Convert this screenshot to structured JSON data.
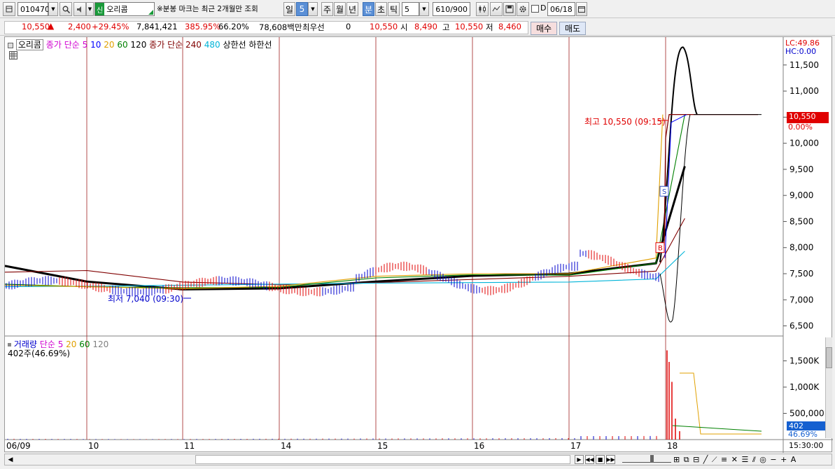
{
  "toolbar": {
    "code": "010470",
    "sin_badge": "신",
    "stock_name": "오리콤",
    "note": "※분봉 마크는 최근 2개월만 조회",
    "periods": [
      "일",
      "5",
      "주",
      "월",
      "년",
      "분",
      "초",
      "틱"
    ],
    "interval": "5",
    "count": "610/900",
    "checkbox_label": "D",
    "date": "06/18"
  },
  "quote": {
    "price": "10,550",
    "change": "2,400",
    "change_pct": "+29.45%",
    "volume": "7,841,421",
    "volume_ratio": "385.95%",
    "turnover_rate": "66.20%",
    "amount": "78,608백만",
    "best_label": "최우선",
    "best_value": "0",
    "price2": "10,550",
    "open_label": "시",
    "open": "8,490",
    "high_label": "고",
    "high": "10,550",
    "low_label": "저",
    "low": "8,460",
    "buy": "매수",
    "sell": "매도"
  },
  "price_legend": {
    "name": "오리콤",
    "close_label": "종가",
    "simple_label": "단순",
    "ma": [
      "5",
      "10",
      "20",
      "60",
      "120"
    ],
    "close_label2": "종가",
    "simple_label2": "단순",
    "ma2": [
      "240",
      "480"
    ],
    "upper": "상한선",
    "lower": "하한선"
  },
  "volume_legend": {
    "name": "거래량",
    "simple_label": "단순",
    "ma": [
      "5",
      "20",
      "60",
      "120"
    ],
    "current": "402주(46.69%)"
  },
  "annotations": {
    "high": "최고 10,550 (09:15)",
    "low": "최저 7,040 (09:30)",
    "sell_marker": "S",
    "buy_marker": "B",
    "lc": "LC:49.86",
    "hc": "HC:0.00",
    "last_price": "10,550",
    "last_pct": "0.00%",
    "vol_last": "402",
    "vol_pct": "46.69%",
    "time": "15:30:00"
  },
  "colors": {
    "up": "#e00000",
    "down": "#0000cc",
    "ma5": "#d000d0",
    "ma10": "#0000ff",
    "ma20": "#e0a000",
    "ma60": "#008000",
    "ma120": "#808080",
    "ma240": "#800000",
    "ma480": "#00b4d8"
  },
  "chart_data": {
    "type": "line",
    "price_axis": [
      "11,500",
      "11,000",
      "10,500",
      "10,000",
      "9,500",
      "9,000",
      "8,500",
      "8,000",
      "7,500",
      "7,000",
      "6,500"
    ],
    "volume_axis": [
      "1,500K",
      "1,000K",
      "500,000"
    ],
    "date_labels": [
      "06/09",
      "10",
      "11",
      "14",
      "15",
      "16",
      "17",
      "18"
    ],
    "ylim": [
      6400,
      11900
    ],
    "series": [
      {
        "name": "120",
        "color": "#000000",
        "x": [
          0,
          1,
          2,
          3,
          4,
          5,
          6,
          6.9,
          7.2
        ],
        "values": [
          7650,
          7350,
          7200,
          7220,
          7350,
          7460,
          7500,
          7700,
          9560
        ]
      },
      {
        "name": "240",
        "color": "#800000",
        "x": [
          0,
          1,
          2,
          3,
          4,
          5,
          6,
          6.9,
          7.2
        ],
        "values": [
          7530,
          7560,
          7340,
          7290,
          7330,
          7390,
          7450,
          7550,
          8560
        ]
      },
      {
        "name": "480",
        "color": "#00b4d8",
        "x": [
          0,
          1,
          2,
          3,
          4,
          5,
          6,
          6.9,
          7.2
        ],
        "values": [
          7250,
          7260,
          7280,
          7300,
          7320,
          7330,
          7340,
          7400,
          7930
        ]
      },
      {
        "name": "60",
        "color": "#008000",
        "x": [
          0,
          1,
          2,
          3,
          4,
          5,
          6,
          6.9,
          7.2
        ],
        "values": [
          7300,
          7250,
          7230,
          7240,
          7420,
          7480,
          7470,
          7700,
          10550
        ]
      },
      {
        "name": "20",
        "color": "#e0a000",
        "x": [
          0,
          1,
          2,
          3,
          4,
          5,
          6,
          6.9,
          6.97
        ],
        "values": [
          7280,
          7250,
          7210,
          7260,
          7450,
          7500,
          7500,
          7800,
          10550
        ]
      }
    ],
    "price_range": {
      "high": 10550,
      "low": 7040
    }
  }
}
